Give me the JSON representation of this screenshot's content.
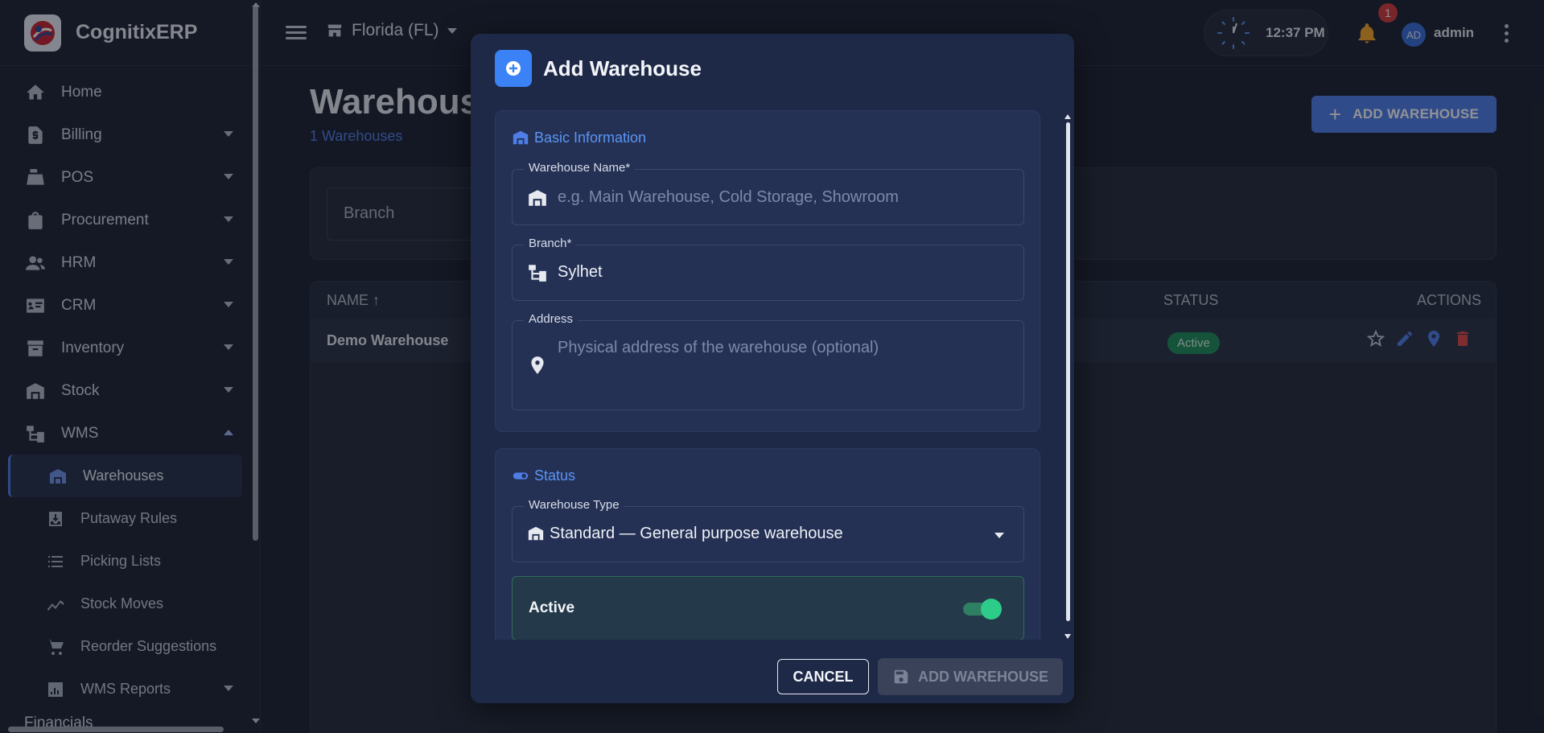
{
  "app": {
    "name": "CognitixERP"
  },
  "sidebar": {
    "items": [
      {
        "label": "Home",
        "icon": "home-icon"
      },
      {
        "label": "Billing",
        "icon": "receipt-icon"
      },
      {
        "label": "POS",
        "icon": "cash-register-icon"
      },
      {
        "label": "Procurement",
        "icon": "shopping-bag-icon"
      },
      {
        "label": "HRM",
        "icon": "people-icon"
      },
      {
        "label": "CRM",
        "icon": "contact-card-icon"
      },
      {
        "label": "Inventory",
        "icon": "archive-icon"
      },
      {
        "label": "Stock",
        "icon": "warehouse-icon"
      },
      {
        "label": "WMS",
        "icon": "hierarchy-icon"
      }
    ],
    "wms_children": [
      {
        "label": "Warehouses",
        "icon": "warehouse-icon"
      },
      {
        "label": "Putaway Rules",
        "icon": "inbox-download-icon"
      },
      {
        "label": "Picking Lists",
        "icon": "list-icon"
      },
      {
        "label": "Stock Moves",
        "icon": "trend-icon"
      },
      {
        "label": "Reorder Suggestions",
        "icon": "cart-icon"
      },
      {
        "label": "WMS Reports",
        "icon": "bar-chart-icon"
      }
    ],
    "partial_item": "Financials"
  },
  "topbar": {
    "store": "Florida (FL)",
    "time": "12:37 PM",
    "notifications": "1",
    "avatar_initials": "AD",
    "username": "admin"
  },
  "page": {
    "title": "Warehouses",
    "subtitle": "1 Warehouses",
    "add_button": "ADD WAREHOUSE",
    "filter_branch": "Branch",
    "table": {
      "columns": [
        "NAME",
        "STATUS",
        "ACTIONS"
      ],
      "rows": [
        {
          "name": "Demo Warehouse",
          "status": "Active"
        }
      ]
    }
  },
  "dialog": {
    "title": "Add Warehouse",
    "basic_section": "Basic Information",
    "name_label": "Warehouse Name*",
    "name_placeholder": "e.g. Main Warehouse, Cold Storage, Showroom",
    "branch_label": "Branch*",
    "branch_value": "Sylhet",
    "address_label": "Address",
    "address_placeholder": "Physical address of the warehouse (optional)",
    "status_section": "Status",
    "type_label": "Warehouse Type",
    "type_value": "Standard — General purpose warehouse",
    "active_label": "Active",
    "active_on": true,
    "cancel": "CANCEL",
    "submit": "ADD WAREHOUSE"
  },
  "colors": {
    "accent": "#4f7ee8",
    "success": "#2ecc8a",
    "danger": "#e04848",
    "warning": "#f5a623"
  }
}
